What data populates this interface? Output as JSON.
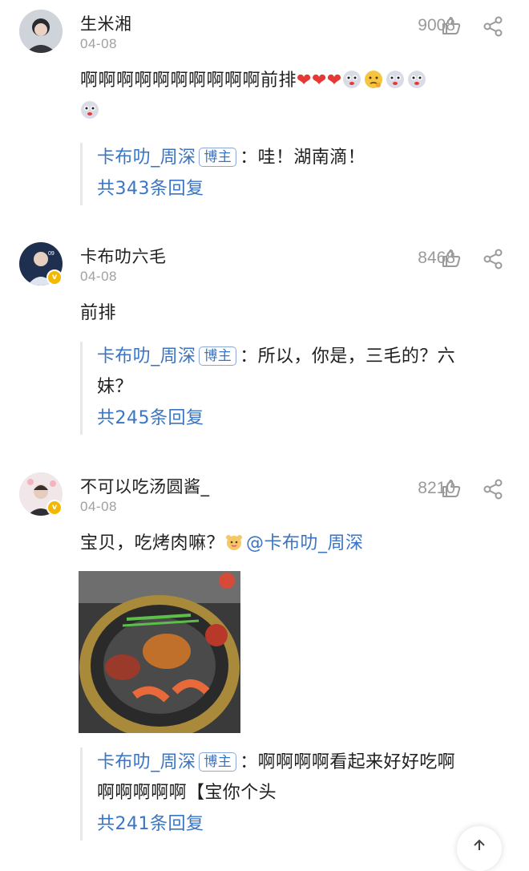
{
  "comments": [
    {
      "username": "生米湘",
      "date": "04-08",
      "likes": "9008",
      "text_line1": "啊啊啊啊啊啊啊啊啊啊前排",
      "reply": {
        "author": "卡布叻_周深",
        "tag": "博主",
        "text": "：哇！湖南滴！",
        "count": "共343条回复"
      }
    },
    {
      "username": "卡布叻六毛",
      "date": "04-08",
      "likes": "8468",
      "text_line1": "前排",
      "reply": {
        "author": "卡布叻_周深",
        "tag": "博主",
        "text": "：所以，你是，三毛的？六",
        "text2": "妹？",
        "count": "共245条回复"
      }
    },
    {
      "username": "不可以吃汤圆酱_",
      "date": "04-08",
      "likes": "8210",
      "text_line1": "宝贝，吃烤肉嘛？",
      "mention": "@卡布叻_周深",
      "reply": {
        "author": "卡布叻_周深",
        "tag": "博主",
        "text": "：啊啊啊啊看起来好好吃啊",
        "text2": "啊啊啊啊啊【宝你个头",
        "count": "共241条回复"
      }
    }
  ],
  "colors": {
    "link": "#3a75c4",
    "muted": "#a0a0a0",
    "heart": "#e53935"
  },
  "icons": [
    "thumbs-up-icon",
    "share-icon",
    "verified-badge-icon",
    "heart-emoji",
    "dog-emoji",
    "thinking-emoji",
    "scroll-top-icon"
  ]
}
